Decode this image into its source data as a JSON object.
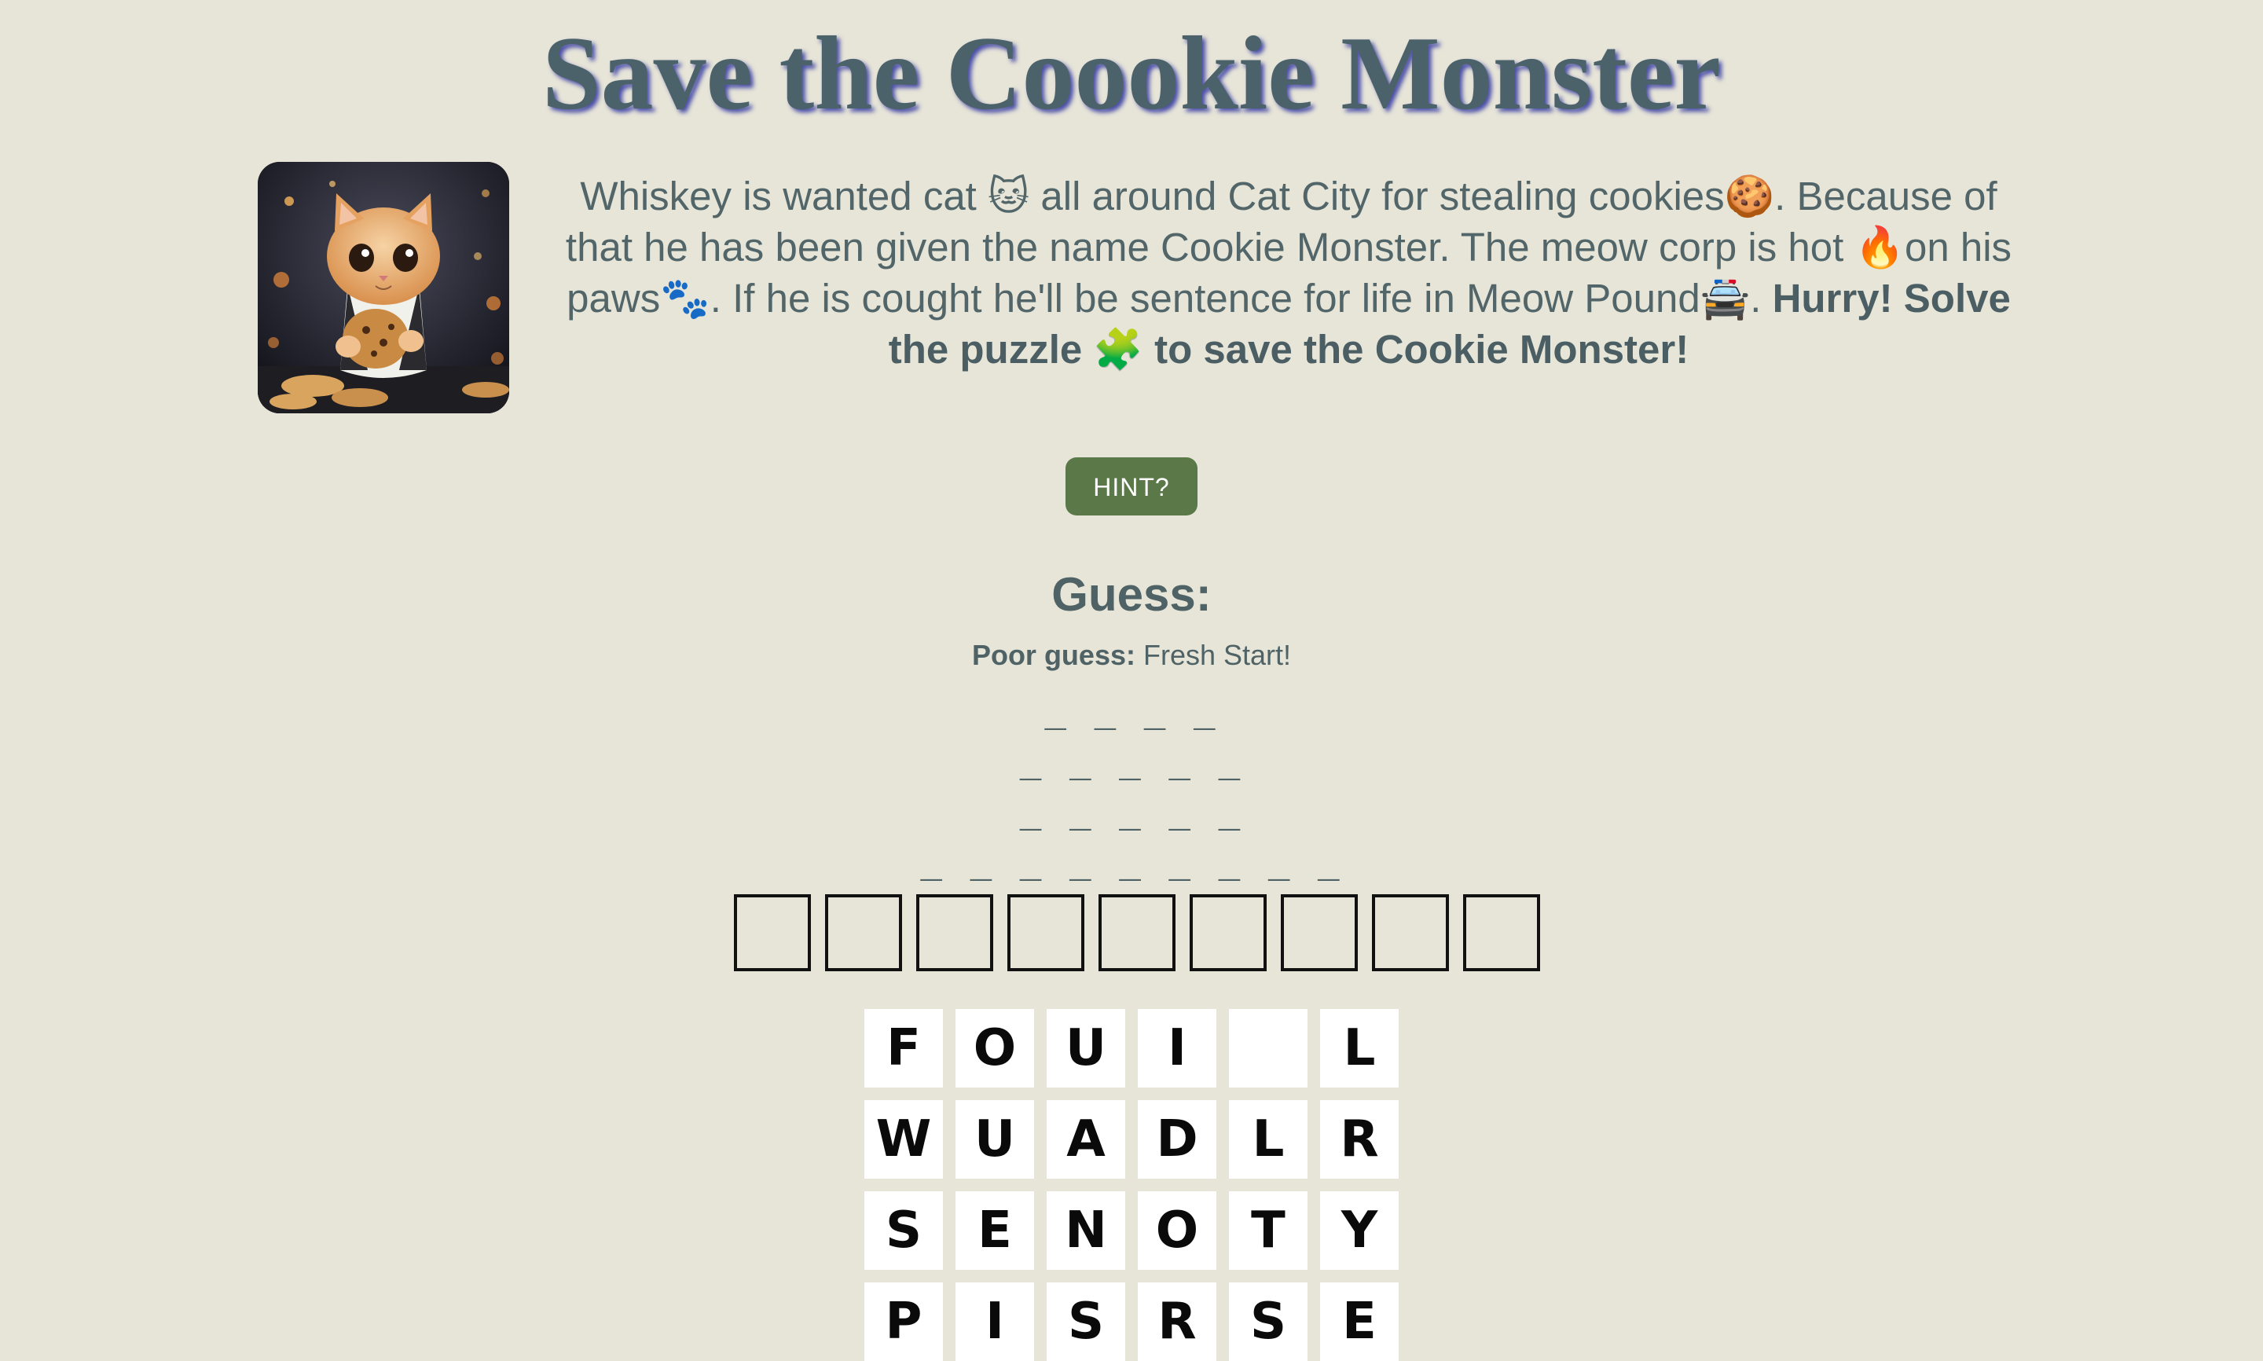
{
  "title": "Save the Coookie Monster",
  "story": {
    "part1": "Whiskey is wanted cat ",
    "emoji_cat": "🐱",
    "part2": " all around Cat City for stealing cookies",
    "emoji_cookie": "🍪",
    "part3": ". Because of that he has been given the name Cookie Monster. The meow corp is hot ",
    "emoji_fire": "🔥",
    "part4": "on his paws",
    "emoji_paws": "🐾",
    "part5": ". If he is cought he'll be sentence for life in Meow Pound",
    "emoji_police": "🚔",
    "part6": ". ",
    "bold_part1": "Hurry! Solve the puzzle ",
    "emoji_puzzle": "🧩",
    "bold_part2": " to save the Cookie Monster!"
  },
  "hint_button": "HINT?",
  "guess": {
    "heading": "Guess:",
    "status_label": "Poor guess:",
    "status_value": " Fresh Start!"
  },
  "word_lines": [
    "_ _ _ _",
    "_ _ _ _ _",
    "_ _ _ _ _",
    "_ _ _ _ _ _ _ _ _"
  ],
  "answer_box_count": 9,
  "letter_grid": [
    [
      "F",
      "O",
      "U",
      "I",
      "",
      "L"
    ],
    [
      "W",
      "U",
      "A",
      "D",
      "L",
      "R"
    ],
    [
      "S",
      "E",
      "N",
      "O",
      "T",
      "Y"
    ],
    [
      "P",
      "I",
      "S",
      "R",
      "S",
      "E"
    ]
  ],
  "colors": {
    "background": "#e7e5d8",
    "text": "#4f6366",
    "hint_button": "#5a7848",
    "title_shadow": "#4a4ea8"
  }
}
